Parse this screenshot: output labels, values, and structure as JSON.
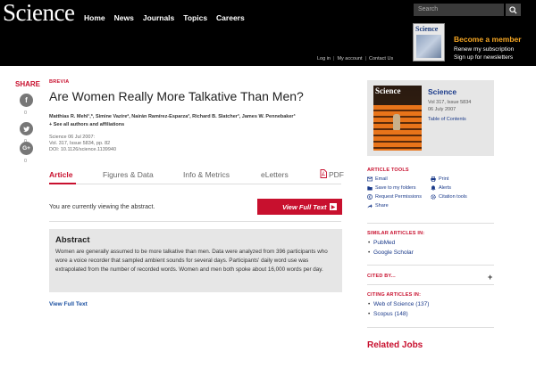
{
  "header": {
    "logo": "Science",
    "nav": [
      "Home",
      "News",
      "Journals",
      "Topics",
      "Careers"
    ],
    "search_placeholder": "Search",
    "member": {
      "title": "Become a member",
      "line1": "Renew my subscription",
      "line2": "Sign up for newsletters"
    },
    "account": {
      "login": "Log in",
      "my_account": "My account",
      "contact": "Contact Us"
    },
    "cover_title": "Science"
  },
  "share": {
    "label": "SHARE",
    "facebook": {
      "glyph": "f",
      "count": "0"
    },
    "twitter": {
      "glyph": "t",
      "count": "0"
    },
    "google": {
      "glyph": "G+",
      "count": "0"
    }
  },
  "article": {
    "kicker": "BREVIA",
    "title": "Are Women Really More Talkative Than Men?",
    "authors": "Matthias R. Mehl¹,*, Simine Vazire², Nairán Ramírez-Esparza³, Richard B. Slatcher³, James W. Pennebaker³",
    "see_all": "+ See all authors and affiliations",
    "meta": [
      "Science  06 Jul 2007:",
      "Vol. 317, Issue 5834, pp. 82",
      "DOI: 10.1126/science.1139940"
    ],
    "tabs": [
      "Article",
      "Figures & Data",
      "Info & Metrics",
      "eLetters",
      "PDF"
    ],
    "viewing_text": "You are currently viewing the abstract.",
    "full_text_button": "View Full Text",
    "abstract_title": "Abstract",
    "abstract_text": "Women are generally assumed to be more talkative than men. Data were analyzed from 396 participants who wore a voice recorder that sampled ambient sounds for several days. Participants' daily word use was extrapolated from the number of recorded words. Women and men both spoke about 16,000 words per day.",
    "view_full_link": "View Full Text"
  },
  "journal": {
    "cover_title": "Science",
    "name": "Science",
    "vol": "Vol 317, Issue 5834",
    "date": "06 July 2007",
    "toc": "Table of Contents"
  },
  "tools": {
    "heading": "ARTICLE TOOLS",
    "items": [
      "Email",
      "Print",
      "Save to my folders",
      "Alerts",
      "Request Permissions",
      "Citation tools",
      "Share"
    ]
  },
  "similar": {
    "heading": "SIMILAR ARTICLES IN:",
    "links": [
      "PubMed",
      "Google Scholar"
    ]
  },
  "cited_by": {
    "heading": "CITED BY..."
  },
  "citing": {
    "heading": "CITING ARTICLES IN:",
    "links": [
      "Web of Science (137)",
      "Scopus (148)"
    ]
  },
  "related_jobs": "Related Jobs"
}
